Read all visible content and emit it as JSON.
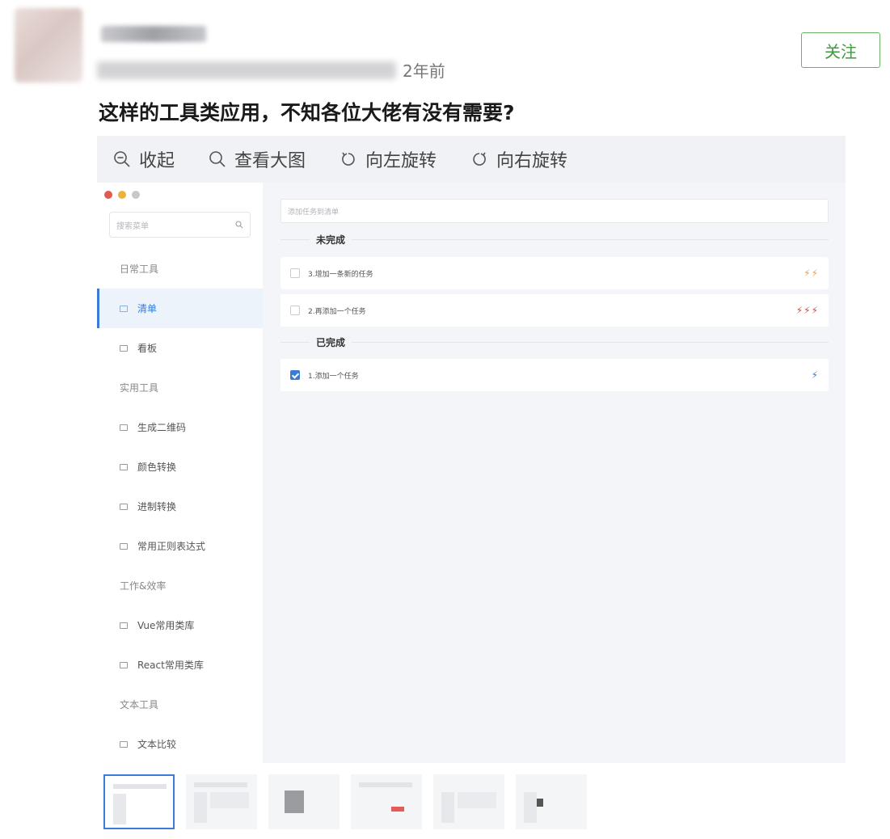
{
  "post": {
    "time_text": "2年前",
    "follow_label": "关注",
    "title": "这样的工具类应用，不知各位大佬有没有需要?"
  },
  "viewer": {
    "toolbar": [
      {
        "icon": "zoom-out-icon",
        "label": "收起"
      },
      {
        "icon": "zoom-in-icon",
        "label": "查看大图"
      },
      {
        "icon": "rotate-left-icon",
        "label": "向左旋转"
      },
      {
        "icon": "rotate-right-icon",
        "label": "向右旋转"
      }
    ]
  },
  "app": {
    "window_dots": [
      "#e05a4f",
      "#e9b43c",
      "#c8c8c8"
    ],
    "search_placeholder": "搜索菜单",
    "sidebar": [
      {
        "type": "group",
        "label": "日常工具"
      },
      {
        "type": "item",
        "label": "清单",
        "active": true
      },
      {
        "type": "item",
        "label": "看板"
      },
      {
        "type": "group",
        "label": "实用工具"
      },
      {
        "type": "item",
        "label": "生成二维码"
      },
      {
        "type": "item",
        "label": "颜色转换"
      },
      {
        "type": "item",
        "label": "进制转换"
      },
      {
        "type": "item",
        "label": "常用正则表达式"
      },
      {
        "type": "group",
        "label": "工作&效率"
      },
      {
        "type": "item",
        "label": "Vue常用类库"
      },
      {
        "type": "item",
        "label": "React常用类库"
      },
      {
        "type": "group",
        "label": "文本工具"
      },
      {
        "type": "item",
        "label": "文本比较"
      }
    ],
    "task_input_placeholder": "添加任务到清单",
    "sections": {
      "pending": {
        "title": "未完成",
        "tasks": [
          {
            "label": "3.增加一条新的任务",
            "priority": "⚡⚡",
            "color": "#e9a53c",
            "done": false
          },
          {
            "label": "2.再添加一个任务",
            "priority": "⚡⚡⚡",
            "color": "#d9483b",
            "done": false
          }
        ]
      },
      "done": {
        "title": "已完成",
        "tasks": [
          {
            "label": "1.添加一个任务",
            "priority": "⚡",
            "color": "#3a7bd5",
            "done": true
          }
        ]
      }
    }
  },
  "accent_color": "#3a7bd5",
  "follow_color": "#3f9a3f"
}
